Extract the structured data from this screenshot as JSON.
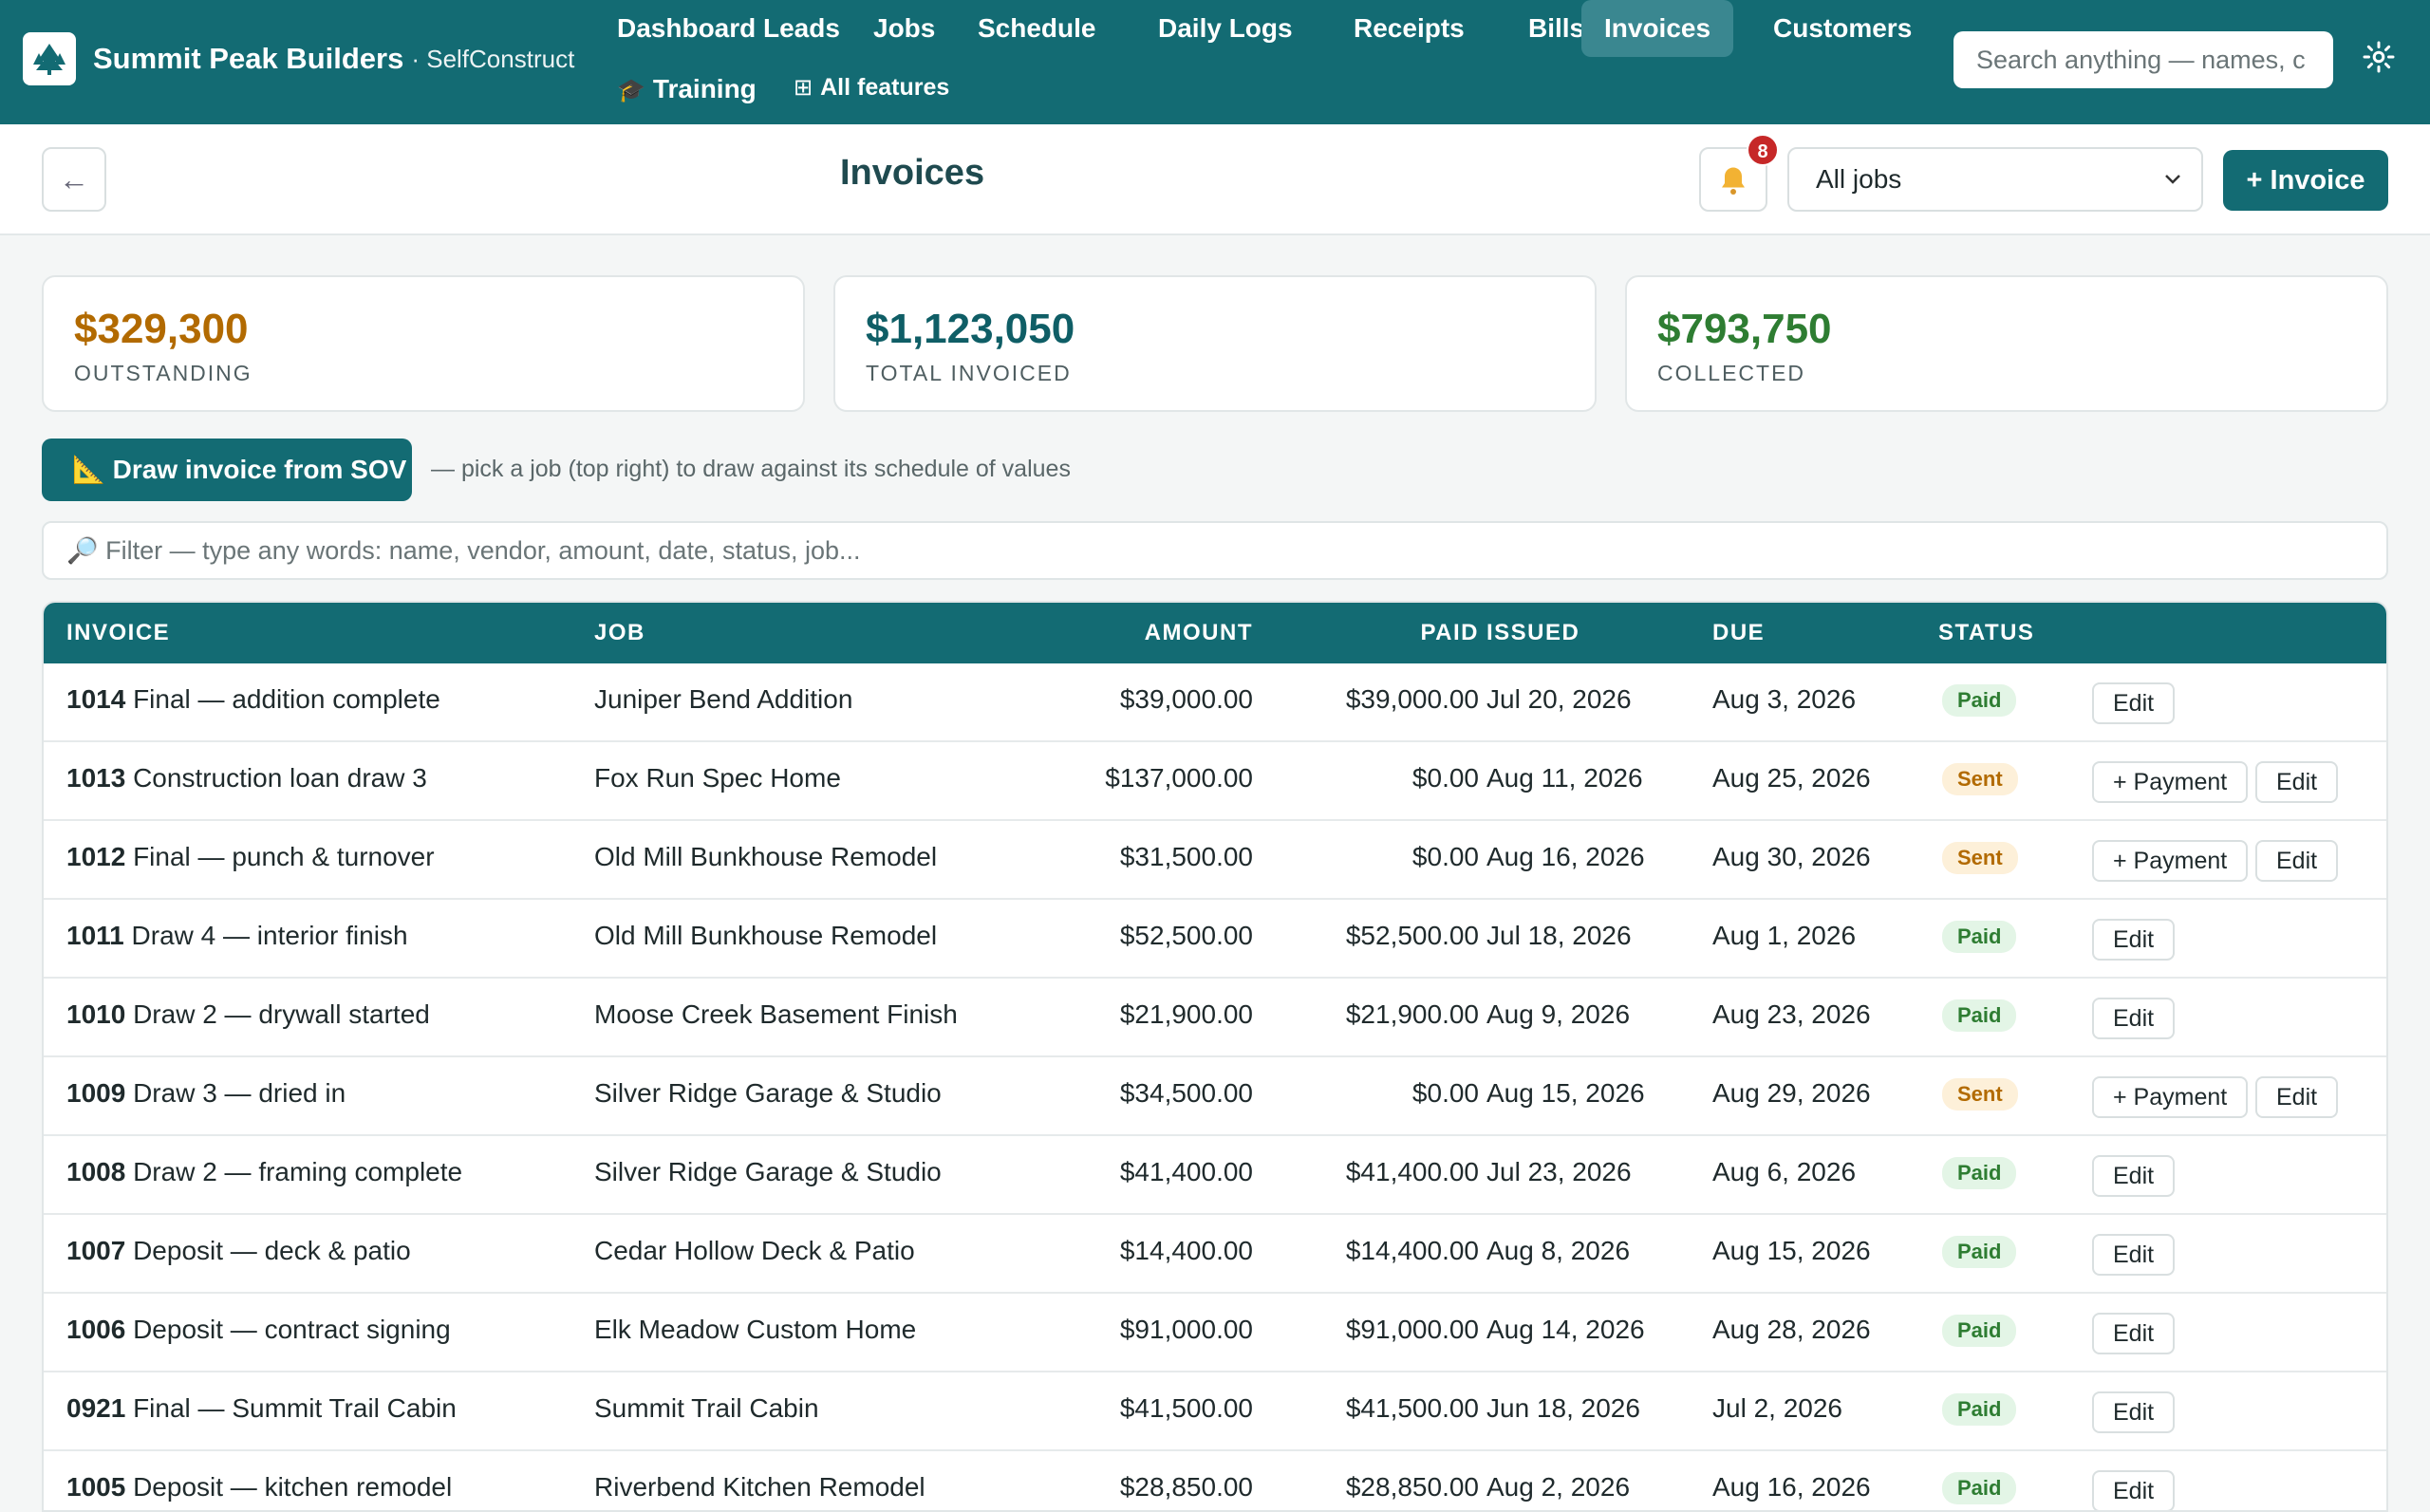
{
  "brand": {
    "name": "Summit Peak Builders",
    "sub": "· SelfConstruct",
    "logo_icon": "tree-icon"
  },
  "nav": {
    "items": [
      "Dashboard",
      "Leads",
      "Jobs",
      "Schedule",
      "Daily Logs",
      "Receipts",
      "Bills",
      "Invoices",
      "Customers"
    ],
    "active": "Invoices",
    "training": "Training",
    "all_features": "All features"
  },
  "search": {
    "placeholder": "Search anything — names, c"
  },
  "header": {
    "title": "Invoices",
    "back_label": "←",
    "notification_count": "8",
    "job_filter": "All jobs",
    "new_invoice": "+ Invoice"
  },
  "summary": [
    {
      "value": "$329,300",
      "label": "OUTSTANDING",
      "color": "#b26a00"
    },
    {
      "value": "$1,123,050",
      "label": "TOTAL INVOICED",
      "color": "#0f5e66"
    },
    {
      "value": "$793,750",
      "label": "COLLECTED",
      "color": "#2e7d32"
    }
  ],
  "sov": {
    "button": "Draw invoice from SOV",
    "hint": "— pick a job (top right) to draw against its schedule of values"
  },
  "filter": {
    "placeholder": "Filter — type any words: name, vendor, amount, date, status, job..."
  },
  "table": {
    "columns": [
      "INVOICE",
      "JOB",
      "AMOUNT",
      "PAID",
      "ISSUED",
      "DUE",
      "STATUS"
    ],
    "rows": [
      {
        "num": "1014",
        "desc": "Final — addition complete",
        "job": "Juniper Bend Addition",
        "amount": "$39,000.00",
        "paid": "$39,000.00",
        "issued": "Jul 20, 2026",
        "due": "Aug 3, 2026",
        "status": "Paid"
      },
      {
        "num": "1013",
        "desc": "Construction loan draw 3",
        "job": "Fox Run Spec Home",
        "amount": "$137,000.00",
        "paid": "$0.00",
        "issued": "Aug 11, 2026",
        "due": "Aug 25, 2026",
        "status": "Sent"
      },
      {
        "num": "1012",
        "desc": "Final — punch & turnover",
        "job": "Old Mill Bunkhouse Remodel",
        "amount": "$31,500.00",
        "paid": "$0.00",
        "issued": "Aug 16, 2026",
        "due": "Aug 30, 2026",
        "status": "Sent"
      },
      {
        "num": "1011",
        "desc": "Draw 4 — interior finish",
        "job": "Old Mill Bunkhouse Remodel",
        "amount": "$52,500.00",
        "paid": "$52,500.00",
        "issued": "Jul 18, 2026",
        "due": "Aug 1, 2026",
        "status": "Paid"
      },
      {
        "num": "1010",
        "desc": "Draw 2 — drywall started",
        "job": "Moose Creek Basement Finish",
        "amount": "$21,900.00",
        "paid": "$21,900.00",
        "issued": "Aug 9, 2026",
        "due": "Aug 23, 2026",
        "status": "Paid"
      },
      {
        "num": "1009",
        "desc": "Draw 3 — dried in",
        "job": "Silver Ridge Garage & Studio",
        "amount": "$34,500.00",
        "paid": "$0.00",
        "issued": "Aug 15, 2026",
        "due": "Aug 29, 2026",
        "status": "Sent"
      },
      {
        "num": "1008",
        "desc": "Draw 2 — framing complete",
        "job": "Silver Ridge Garage & Studio",
        "amount": "$41,400.00",
        "paid": "$41,400.00",
        "issued": "Jul 23, 2026",
        "due": "Aug 6, 2026",
        "status": "Paid"
      },
      {
        "num": "1007",
        "desc": "Deposit — deck & patio",
        "job": "Cedar Hollow Deck & Patio",
        "amount": "$14,400.00",
        "paid": "$14,400.00",
        "issued": "Aug 8, 2026",
        "due": "Aug 15, 2026",
        "status": "Paid"
      },
      {
        "num": "1006",
        "desc": "Deposit — contract signing",
        "job": "Elk Meadow Custom Home",
        "amount": "$91,000.00",
        "paid": "$91,000.00",
        "issued": "Aug 14, 2026",
        "due": "Aug 28, 2026",
        "status": "Paid"
      },
      {
        "num": "0921",
        "desc": "Final — Summit Trail Cabin",
        "job": "Summit Trail Cabin",
        "amount": "$41,500.00",
        "paid": "$41,500.00",
        "issued": "Jun 18, 2026",
        "due": "Jul 2, 2026",
        "status": "Paid"
      },
      {
        "num": "1005",
        "desc": "Deposit — kitchen remodel",
        "job": "Riverbend Kitchen Remodel",
        "amount": "$28,850.00",
        "paid": "$28,850.00",
        "issued": "Aug 2, 2026",
        "due": "Aug 16, 2026",
        "status": "Paid"
      }
    ],
    "actions": {
      "payment": "+ Payment",
      "edit": "Edit"
    }
  }
}
